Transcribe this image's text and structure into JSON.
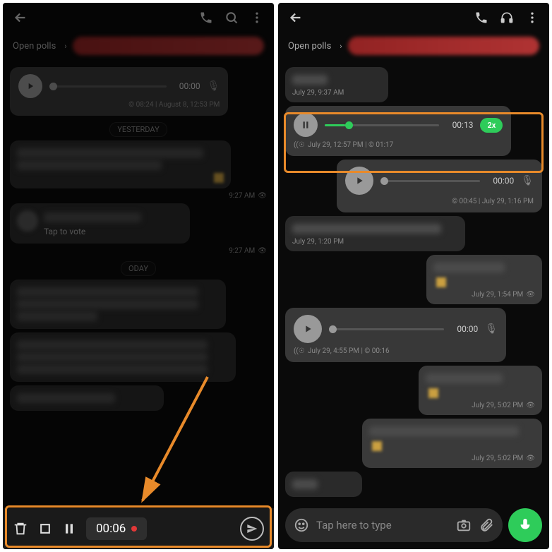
{
  "left": {
    "polls": "Open polls",
    "msg1": {
      "time": "00:00",
      "meta": "© 08:24 | August 8, 12:53 PM"
    },
    "chip1": "YESTERDAY",
    "vote": {
      "tap": "Tap to vote",
      "t1": "9:27 AM",
      "t2": "9:27 AM"
    },
    "chip2": "ODAY",
    "rec": {
      "time": "00:06"
    }
  },
  "right": {
    "polls": "Open polls",
    "in1": "July 29, 9:37 AM",
    "voice": {
      "time": "00:13",
      "speed": "2x",
      "meta": "July 29, 12:57 PM | © 01:17"
    },
    "audio2": {
      "time": "00:00",
      "meta": "© 00:45 | July 29, 1:16 PM"
    },
    "in2": "July 29, 1:20 PM",
    "out1": "July 29, 1:54 PM",
    "audio3": {
      "time": "00:00",
      "meta": "July 29, 4:55 PM | © 00:16"
    },
    "out2": "July 29, 5:02 PM",
    "out3": "July 29, 5:02 PM",
    "input": "Tap here to type"
  }
}
